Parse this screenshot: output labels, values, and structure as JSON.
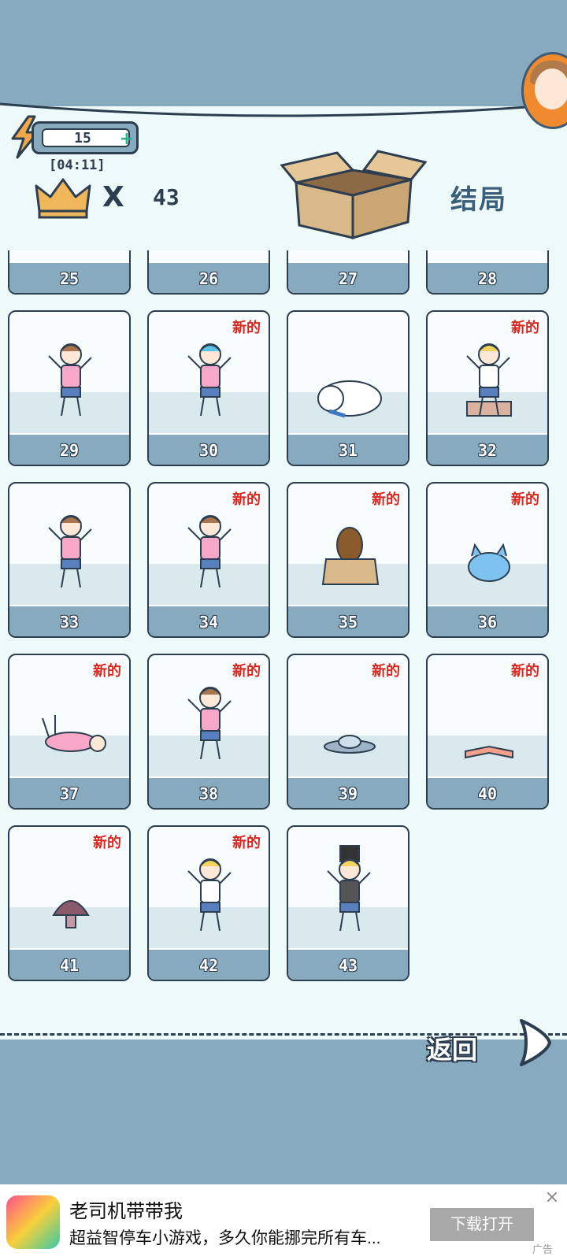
{
  "header": {
    "energy": "15",
    "timer": "[04:11]",
    "multiply_sign": "X",
    "score": "43",
    "ending_label": "结局",
    "icons": [
      "bolt-icon",
      "plus-icon",
      "crown-icon",
      "box-icon",
      "avatar"
    ]
  },
  "colors": {
    "sky": "#87aabf",
    "panel": "#eef9f9",
    "outline": "#2c3e50",
    "new_badge": "#d7261e",
    "energy_plus": "#2bb28c"
  },
  "partial_row": [
    "25",
    "26",
    "27",
    "28"
  ],
  "cards": [
    {
      "num": "29",
      "new": "",
      "art": "girl-jumping"
    },
    {
      "num": "30",
      "new": "新的",
      "art": "girl-jumping-blue-hair"
    },
    {
      "num": "31",
      "new": "",
      "art": "polar-bear"
    },
    {
      "num": "32",
      "new": "新的",
      "art": "boy-in-litter-box"
    },
    {
      "num": "33",
      "new": "",
      "art": "girl-jumping"
    },
    {
      "num": "34",
      "new": "新的",
      "art": "girl-standing"
    },
    {
      "num": "35",
      "new": "新的",
      "art": "dog-in-box"
    },
    {
      "num": "36",
      "new": "新的",
      "art": "blue-cat"
    },
    {
      "num": "37",
      "new": "新的",
      "art": "girl-falling"
    },
    {
      "num": "38",
      "new": "新的",
      "art": "girl-jumping"
    },
    {
      "num": "39",
      "new": "新的",
      "art": "ufo"
    },
    {
      "num": "40",
      "new": "新的",
      "art": "book"
    },
    {
      "num": "41",
      "new": "新的",
      "art": "mushroom"
    },
    {
      "num": "42",
      "new": "新的",
      "art": "doctor"
    },
    {
      "num": "43",
      "new": "",
      "art": "gentleman-top-hat"
    }
  ],
  "back_label": "返回",
  "ad": {
    "title": "老司机带带我",
    "description": "超益智停车小游戏，多久你能挪完所有车...",
    "button": "下载打开",
    "tag": "广告",
    "close": "×"
  }
}
